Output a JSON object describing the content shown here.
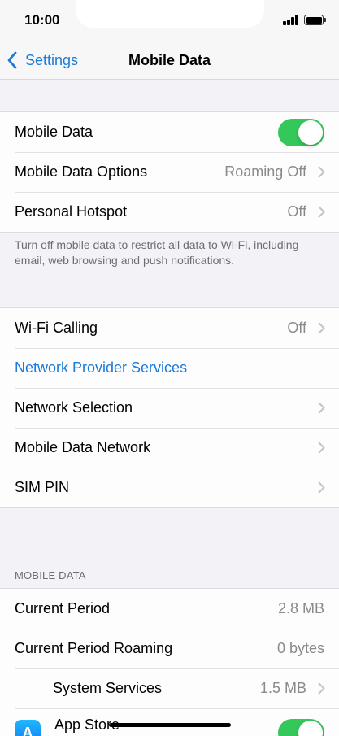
{
  "status_bar": {
    "time": "10:00"
  },
  "nav": {
    "back_label": "Settings",
    "title": "Mobile Data"
  },
  "group1": {
    "mobile_data": {
      "label": "Mobile Data",
      "toggle_on": true
    },
    "mobile_data_options": {
      "label": "Mobile Data Options",
      "value": "Roaming Off"
    },
    "personal_hotspot": {
      "label": "Personal Hotspot",
      "value": "Off"
    },
    "footnote": "Turn off mobile data to restrict all data to Wi-Fi, including email, web browsing and push notifications."
  },
  "group2": {
    "wifi_calling": {
      "label": "Wi-Fi Calling",
      "value": "Off"
    },
    "network_provider_services": {
      "label": "Network Provider Services"
    },
    "network_selection": {
      "label": "Network Selection"
    },
    "mobile_data_network": {
      "label": "Mobile Data Network"
    },
    "sim_pin": {
      "label": "SIM PIN"
    }
  },
  "mobile_data_section": {
    "header": "MOBILE DATA",
    "current_period": {
      "label": "Current Period",
      "value": "2.8 MB"
    },
    "current_period_roaming": {
      "label": "Current Period Roaming",
      "value": "0 bytes"
    },
    "system_services": {
      "label": "System Services",
      "value": "1.5 MB"
    },
    "app_store": {
      "label": "App Store",
      "toggle_on": true
    }
  },
  "icons": {
    "back": "chevron-left-icon",
    "chevron": "chevron-right-icon",
    "app_store": "app-store-icon",
    "app_store_glyph": "A"
  },
  "colors": {
    "accent": "#1a7ad9",
    "toggle_on": "#34c759",
    "background": "#f2f2f7"
  }
}
